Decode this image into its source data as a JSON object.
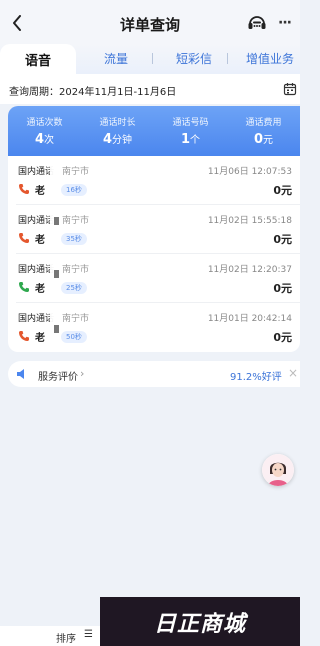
{
  "header": {
    "title": "详单查询",
    "more_label": "···"
  },
  "tabs": [
    {
      "label": "语音",
      "active": true
    },
    {
      "label": "流量",
      "active": false
    },
    {
      "label": "短彩信",
      "active": false
    },
    {
      "label": "增值业务",
      "active": false
    }
  ],
  "period": {
    "text": "查询周期：2024年11月1日-11月6日"
  },
  "summary": [
    {
      "label": "通话次数",
      "value": "4",
      "unit": "次"
    },
    {
      "label": "通话时长",
      "value": "4",
      "unit": "分钟"
    },
    {
      "label": "通话号码",
      "value": "1",
      "unit": "个"
    },
    {
      "label": "通话费用",
      "value": "0",
      "unit": "元"
    }
  ],
  "records": [
    {
      "type": "国内通话",
      "caller": "老",
      "city": "南宁市",
      "duration": "16秒",
      "datetime": "11月06日 12:07:53",
      "fee": "0元",
      "icon_color": "#e4572e"
    },
    {
      "type": "国内通话",
      "caller": "老",
      "city": "南宁市",
      "duration": "35秒",
      "datetime": "11月02日 15:55:18",
      "fee": "0元",
      "icon_color": "#e4572e"
    },
    {
      "type": "国内通话",
      "caller": "老",
      "city": "南宁市",
      "duration": "25秒",
      "datetime": "11月02日 12:20:37",
      "fee": "0元",
      "icon_color": "#2fa84f"
    },
    {
      "type": "国内通话",
      "caller": "老",
      "city": "南宁市",
      "duration": "50秒",
      "datetime": "11月01日 20:42:14",
      "fee": "0元",
      "icon_color": "#e4572e"
    }
  ],
  "rating": {
    "label": "服务评价",
    "chevron": "›",
    "value": "91.2%好评",
    "close": "×"
  },
  "bottom": {
    "sort_label": "排序",
    "sort_icon": "☰"
  },
  "watermark": {
    "text": "日正商城"
  },
  "colors": {
    "accent": "#3c74d8",
    "summary_top": "#6da3f6",
    "summary_bottom": "#4b86ee"
  },
  "icons": {
    "back": "chevron-left-icon",
    "service": "customer-service-icon",
    "calendar": "calendar-icon",
    "speaker": "speaker-icon",
    "phone": "phone-icon"
  }
}
